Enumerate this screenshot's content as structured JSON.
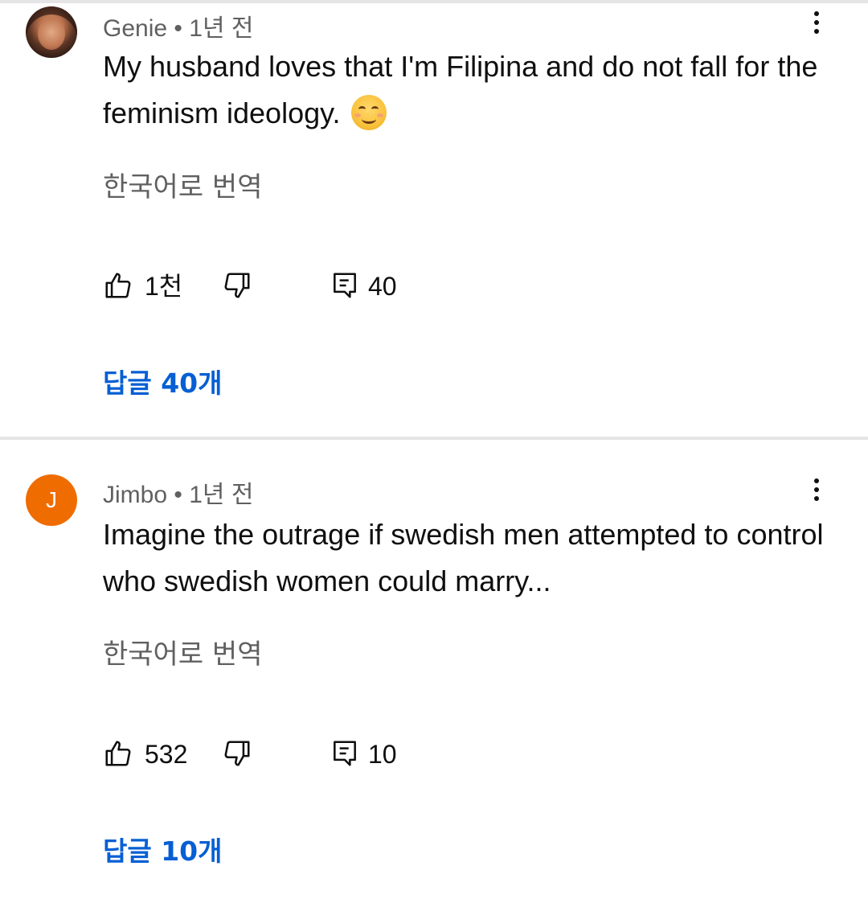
{
  "comments": [
    {
      "author": "Genie",
      "separator": "•",
      "time": "1년 전",
      "avatar_type": "photo",
      "text": "My husband loves that I'm Filipina and do not fall for the feminism ideology.",
      "emoji": "smiling-face-with-smiling-eyes",
      "translate_label": "한국어로 번역",
      "likes": "1천",
      "replies_count": "40",
      "replies_link": "답글 40개"
    },
    {
      "author": "Jimbo",
      "separator": "•",
      "time": "1년 전",
      "avatar_type": "letter",
      "avatar_letter": "J",
      "avatar_color": "#ef6c00",
      "text": "Imagine the outrage if swedish men attempted to control who swedish women could marry...",
      "translate_label": "한국어로 번역",
      "likes": "532",
      "replies_count": "10",
      "replies_link": "답글 10개"
    }
  ],
  "icons": {
    "like": "thumb-up-icon",
    "dislike": "thumb-down-icon",
    "reply": "reply-icon",
    "more": "more-vertical-icon"
  },
  "colors": {
    "link": "#065fd4",
    "secondary_text": "#606060",
    "divider": "#e5e5e5"
  }
}
